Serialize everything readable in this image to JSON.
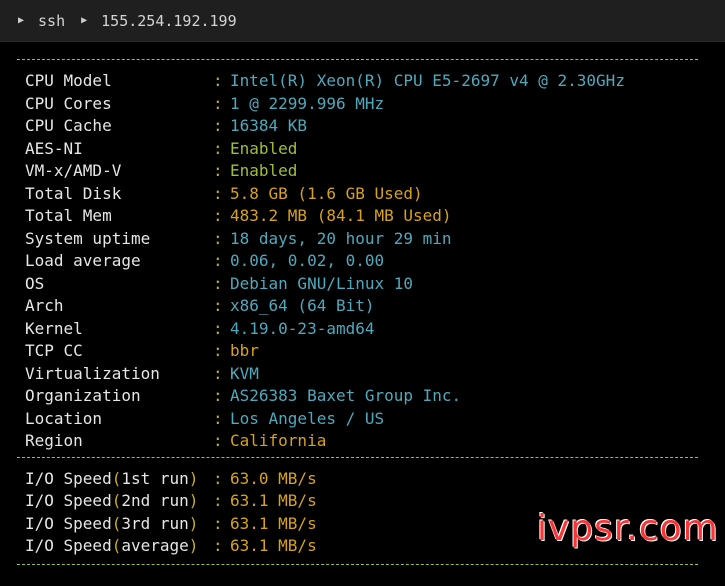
{
  "breadcrumb": {
    "items": [
      "ssh",
      "155.254.192.199"
    ]
  },
  "sysinfo": [
    {
      "label": "CPU Model",
      "value": "Intel(R) Xeon(R) CPU E5-2697 v4 @ 2.30GHz",
      "color": "#4fa9bd"
    },
    {
      "label": "CPU Cores",
      "value": "1 @ 2299.996 MHz",
      "color": "#4fa9bd"
    },
    {
      "label": "CPU Cache",
      "value": "16384 KB",
      "color": "#4fa9bd"
    },
    {
      "label": "AES-NI",
      "value": "Enabled",
      "color": "#9fbf3b"
    },
    {
      "label": "VM-x/AMD-V",
      "value": "Enabled",
      "color": "#9fbf3b"
    },
    {
      "label": "Total Disk",
      "value": "5.8 GB (1.6 GB Used)",
      "color": "#d8a31b"
    },
    {
      "label": "Total Mem",
      "value": "483.2 MB (84.1 MB Used)",
      "color": "#d8a31b"
    },
    {
      "label": "System uptime",
      "value": "18 days, 20 hour 29 min",
      "color": "#4fa9bd"
    },
    {
      "label": "Load average",
      "value": "0.06, 0.02, 0.00",
      "color": "#4fa9bd"
    },
    {
      "label": "OS",
      "value": "Debian GNU/Linux 10",
      "color": "#4fa9bd"
    },
    {
      "label": "Arch",
      "value": "x86_64 (64 Bit)",
      "color": "#4fa9bd"
    },
    {
      "label": "Kernel",
      "value": "4.19.0-23-amd64",
      "color": "#4fa9bd"
    },
    {
      "label": "TCP CC",
      "value": "bbr",
      "color": "#d8a31b"
    },
    {
      "label": "Virtualization",
      "value": "KVM",
      "color": "#4fa9bd"
    },
    {
      "label": "Organization",
      "value": "AS26383 Baxet Group Inc.",
      "color": "#4fa9bd"
    },
    {
      "label": "Location",
      "value": "Los Angeles / US",
      "color": "#4fa9bd"
    },
    {
      "label": "Region",
      "value": "California",
      "color": "#d8a31b"
    }
  ],
  "io_speed": [
    {
      "label": "I/O Speed",
      "run": "1st run",
      "value": "63.0 MB/s"
    },
    {
      "label": "I/O Speed",
      "run": "2nd run",
      "value": "63.1 MB/s"
    },
    {
      "label": "I/O Speed",
      "run": "3rd run",
      "value": "63.1 MB/s"
    },
    {
      "label": "I/O Speed",
      "run": "average",
      "value": "63.1 MB/s"
    }
  ],
  "separator": ":",
  "watermark": "ivpsr.com"
}
